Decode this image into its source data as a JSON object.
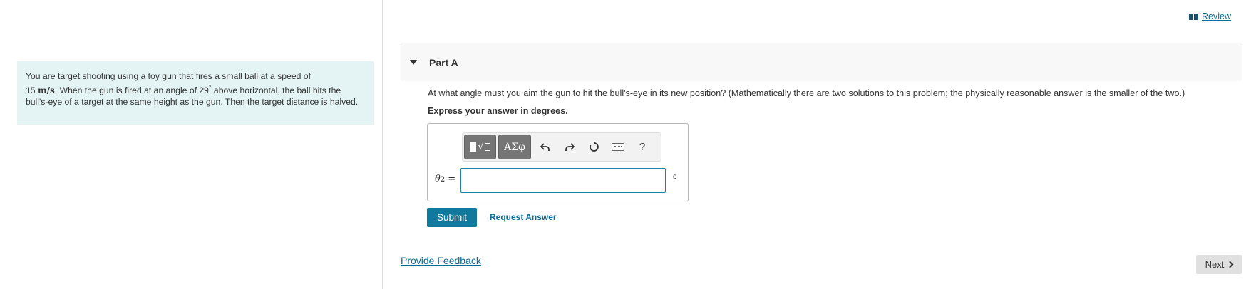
{
  "problem": {
    "text_part1": "You are target shooting using a toy gun that fires a small ball at a speed of",
    "speed_value": "15",
    "speed_unit": "m/s",
    "text_part2": ". When the gun is fired at an angle of 29",
    "degree_symbol": "°",
    "text_part3": " above horizontal, the ball hits the bull's-eye of a target at the same height as the gun. Then the target distance is halved."
  },
  "header": {
    "review_label": "Review"
  },
  "part": {
    "title": "Part A",
    "question": "At what angle must you aim the gun to hit the bull's-eye in its new position? (Mathematically there are two solutions to this problem; the physically reasonable answer is the smaller of the two.)",
    "instruction": "Express your answer in degrees."
  },
  "answer": {
    "variable": "θ",
    "subscript": "2",
    "equals": "=",
    "value": "",
    "unit": "o"
  },
  "toolbar": {
    "symbols_label": "ΑΣφ",
    "undo_icon": "undo-icon",
    "redo_icon": "redo-icon",
    "reset_icon": "reset-icon",
    "keyboard_icon": "keyboard-icon",
    "help_label": "?"
  },
  "actions": {
    "submit_label": "Submit",
    "request_answer_label": "Request Answer",
    "feedback_label": "Provide Feedback",
    "next_label": "Next"
  },
  "colors": {
    "accent": "#0f7a9e",
    "problem_bg": "#e4f4f5",
    "link": "#0a6c97"
  }
}
